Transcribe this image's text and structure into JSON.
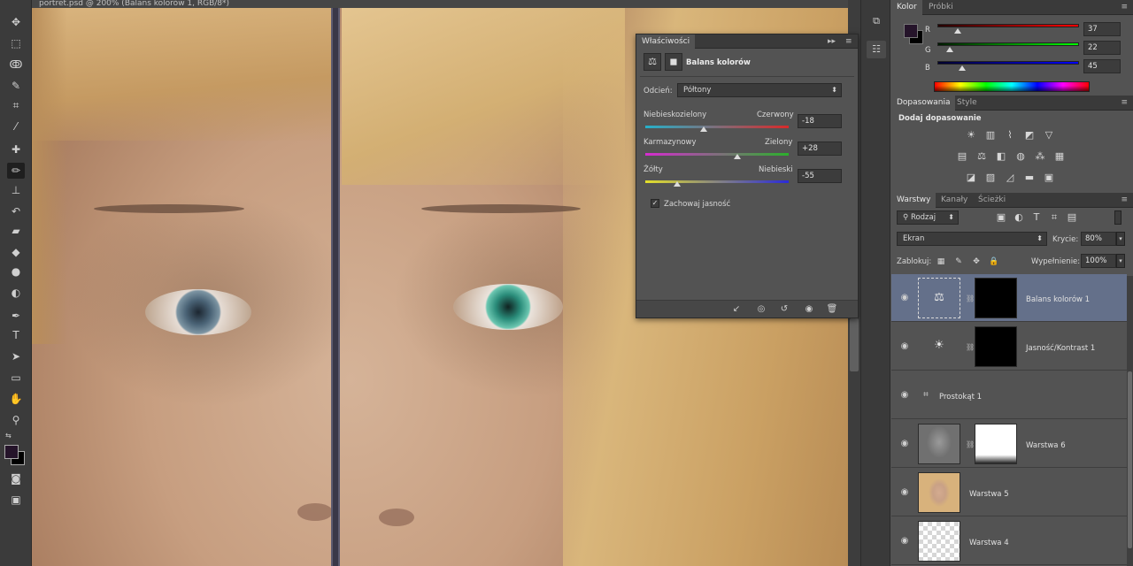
{
  "document": {
    "tab_title": "portret.psd @ 200% (Balans kolorów 1, RGB/8*)"
  },
  "toolbar": {
    "icons": [
      "move-icon",
      "marquee-icon",
      "lasso-icon",
      "quick-select-icon",
      "crop-icon",
      "eyedropper-icon",
      "healing-icon",
      "brush-icon",
      "stamp-icon",
      "history-brush-icon",
      "eraser-icon",
      "bucket-icon",
      "blur-icon",
      "dodge-icon",
      "pen-icon",
      "type-icon",
      "path-select-icon",
      "rectangle-icon",
      "hand-icon",
      "zoom-icon"
    ],
    "active_tool": "brush-icon",
    "fg_color": "#25142a",
    "bg_color": "#000000"
  },
  "properties": {
    "tab_label": "Właściwości",
    "title": "Balans kolorów",
    "tone_label": "Odcień:",
    "tone_value": "Półtony",
    "sliders": [
      {
        "left": "Niebieskozielony",
        "right": "Czerwony",
        "value": "-18",
        "num": -18,
        "gradient": [
          "#26b0c9",
          "#d82a2a"
        ]
      },
      {
        "left": "Karmazynowy",
        "right": "Zielony",
        "value": "+28",
        "num": 28,
        "gradient": [
          "#d62bd0",
          "#2bb02b"
        ]
      },
      {
        "left": "Żółty",
        "right": "Niebieski",
        "value": "-55",
        "num": -55,
        "gradient": [
          "#e3df2a",
          "#2a2ad8"
        ]
      }
    ],
    "preserve_label": "Zachowaj jasność",
    "preserve_checked": true
  },
  "color_panel": {
    "tabs": [
      "Kolor",
      "Próbki"
    ],
    "fg": "#25142a",
    "channels": [
      {
        "label": "R",
        "value": "37",
        "num": 37,
        "gradient": [
          "#250000",
          "#ff0000"
        ]
      },
      {
        "label": "G",
        "value": "22",
        "num": 22,
        "gradient": [
          "#001a00",
          "#00ff00"
        ]
      },
      {
        "label": "B",
        "value": "45",
        "num": 45,
        "gradient": [
          "#00002d",
          "#0000ff"
        ]
      }
    ]
  },
  "adjustments_panel": {
    "tabs": [
      "Dopasowania",
      "Style"
    ],
    "heading": "Dodaj dopasowanie"
  },
  "layers_panel": {
    "tabs": [
      "Warstwy",
      "Kanały",
      "Ścieżki"
    ],
    "filter_label": "Rodzaj",
    "blend_mode": "Ekran",
    "opacity_label": "Krycie:",
    "opacity_value": "80%",
    "lock_label": "Zablokuj:",
    "fill_label": "Wypełnienie:",
    "fill_value": "100%",
    "layers": [
      {
        "name": "Balans kolorów 1",
        "selected": true
      },
      {
        "name": "Jasność/Kontrast 1",
        "selected": false
      },
      {
        "name": "Prostokąt 1",
        "selected": false
      },
      {
        "name": "Warstwa 6",
        "selected": false
      },
      {
        "name": "Warstwa 5",
        "selected": false
      },
      {
        "name": "Warstwa 4",
        "selected": false
      }
    ]
  }
}
